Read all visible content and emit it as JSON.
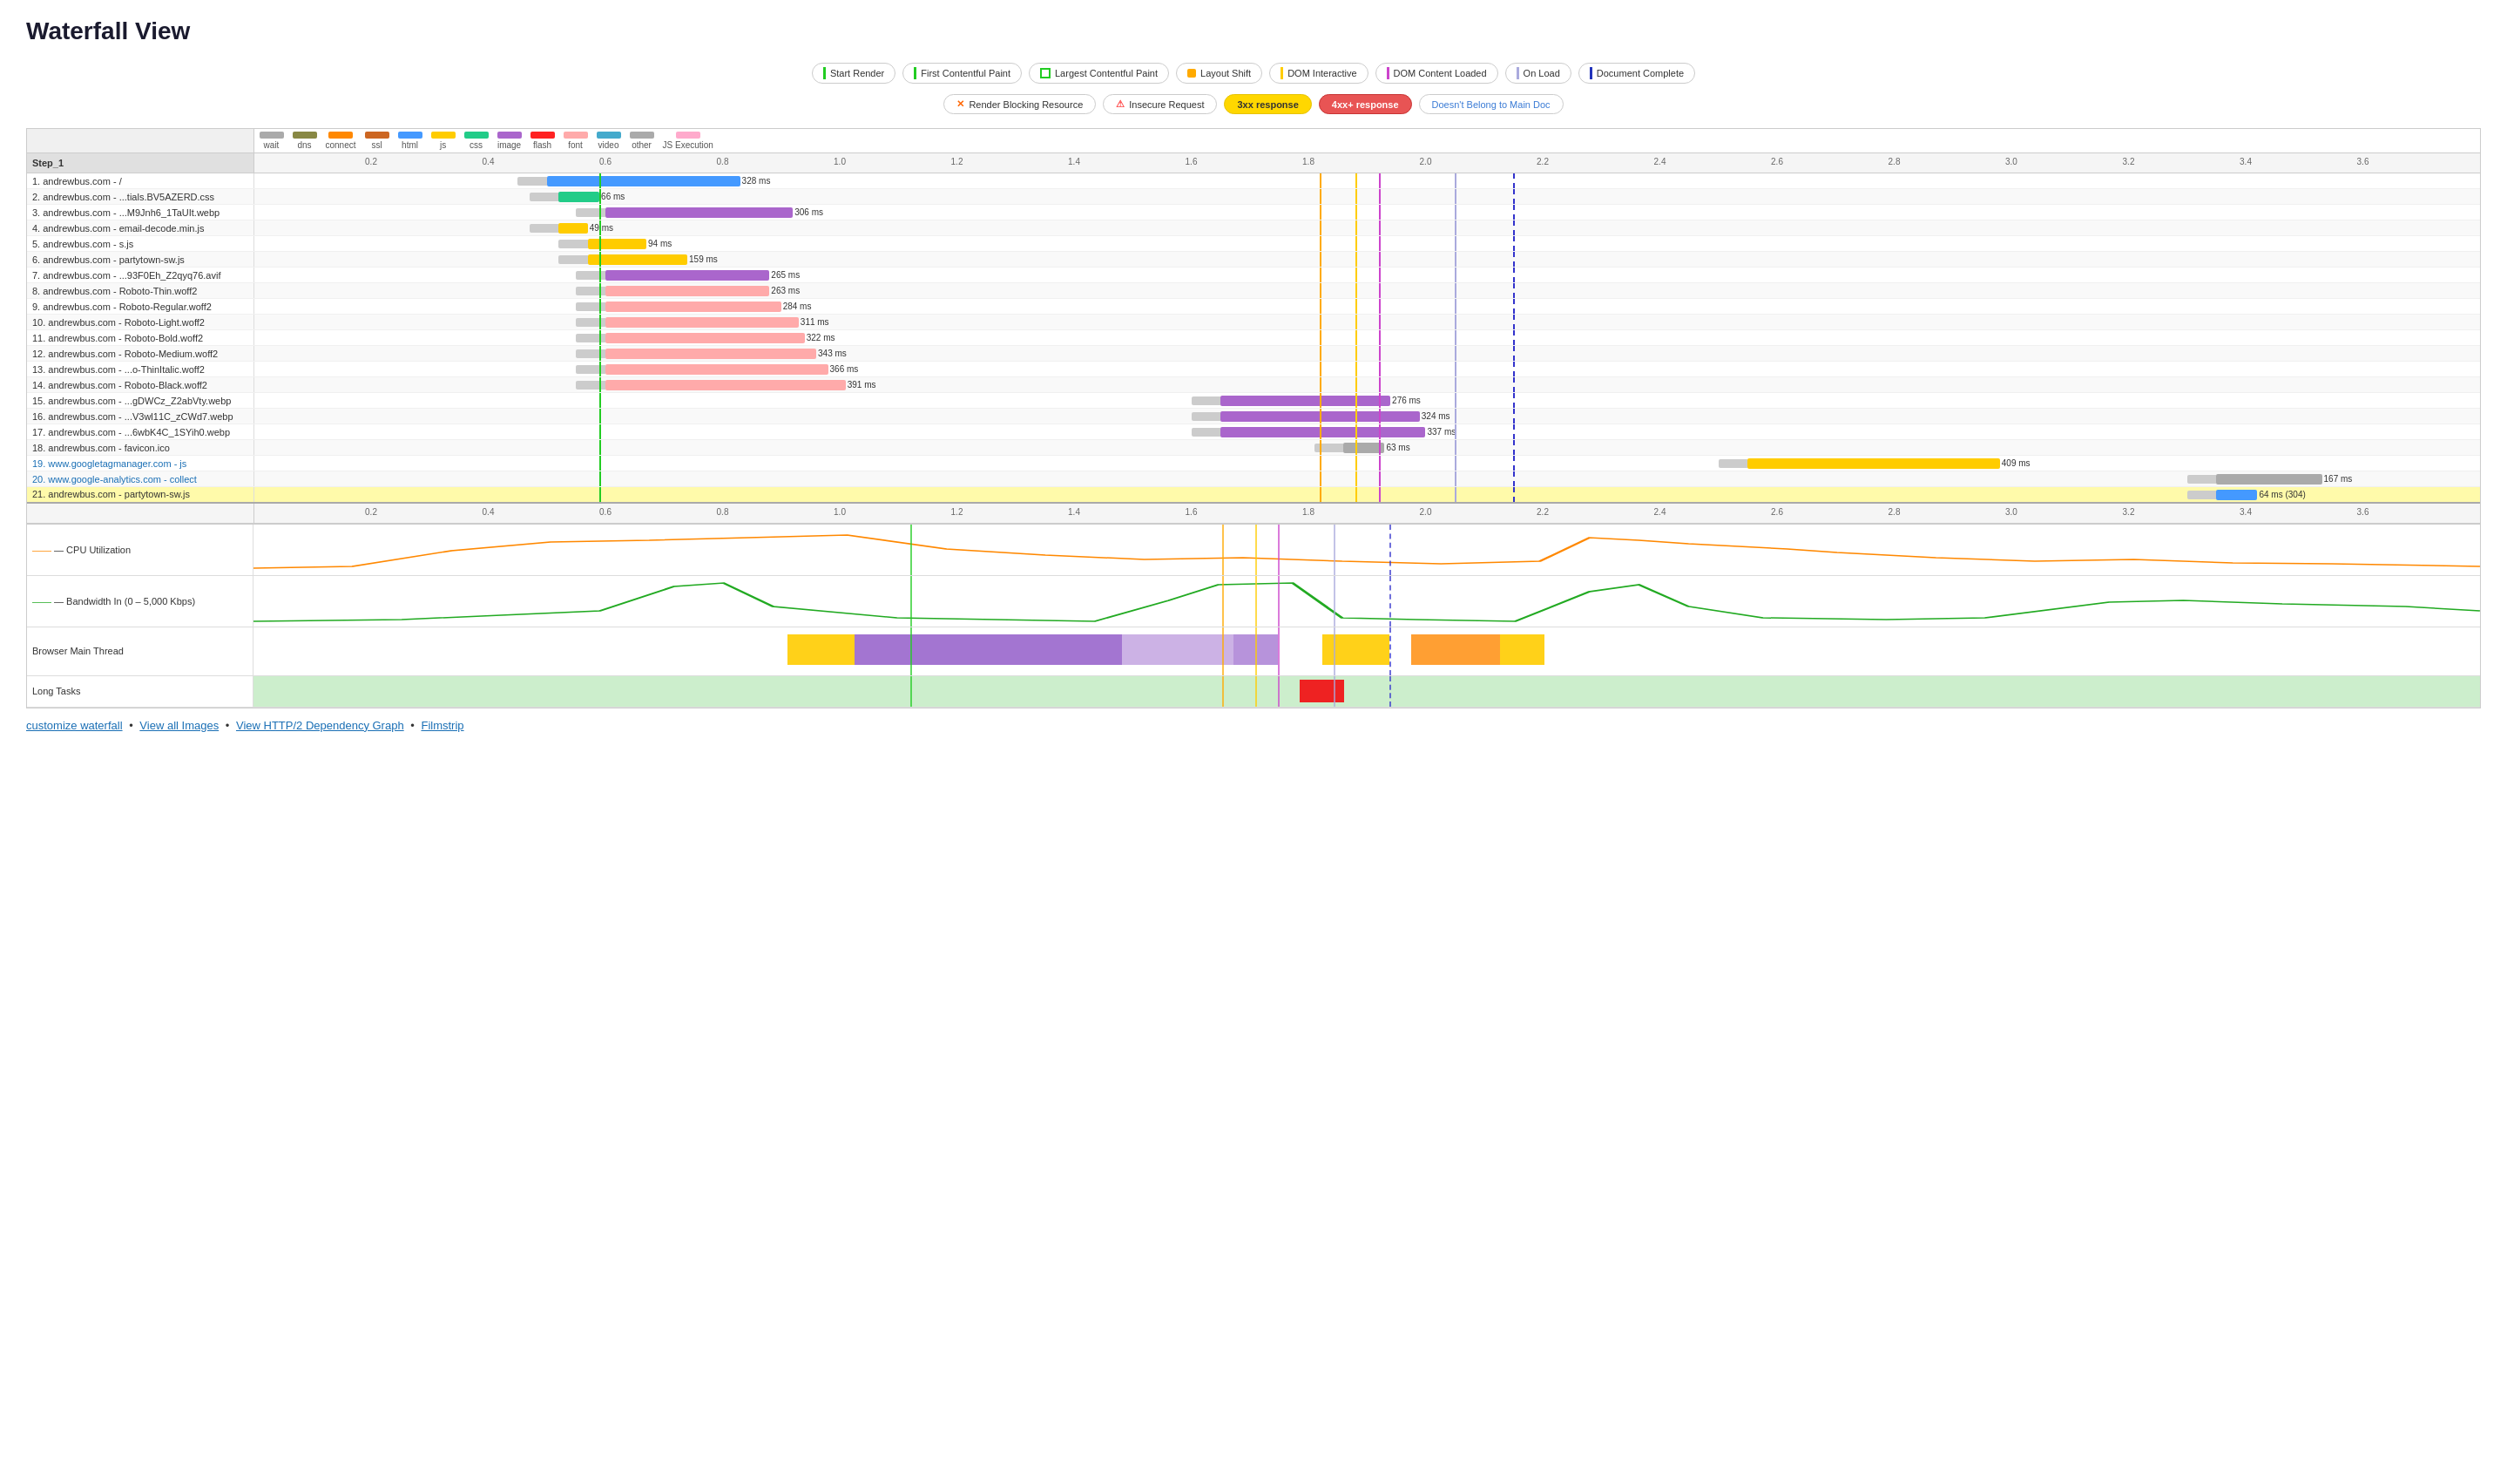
{
  "title": "Waterfall View",
  "legend1": [
    {
      "id": "start-render",
      "label": "Start Render",
      "color": "#22cc22",
      "type": "line"
    },
    {
      "id": "first-contentful-paint",
      "label": "First Contentful Paint",
      "color": "#22cc22",
      "type": "line"
    },
    {
      "id": "largest-contentful-paint",
      "label": "Largest Contentful Paint",
      "color": "#22cc22",
      "type": "dashed"
    },
    {
      "id": "layout-shift",
      "label": "Layout Shift",
      "color": "#ffaa00",
      "type": "dot"
    },
    {
      "id": "dom-interactive",
      "label": "DOM Interactive",
      "color": "#ffcc00",
      "type": "line"
    },
    {
      "id": "dom-content-loaded",
      "label": "DOM Content Loaded",
      "color": "#cc44cc",
      "type": "line"
    },
    {
      "id": "on-load",
      "label": "On Load",
      "color": "#bbbbee",
      "type": "line"
    },
    {
      "id": "document-complete",
      "label": "Document Complete",
      "color": "#1133cc",
      "type": "line"
    }
  ],
  "legend2": [
    {
      "id": "render-blocking",
      "label": "Render Blocking Resource",
      "type": "x-circle",
      "color": "#ff6600"
    },
    {
      "id": "insecure",
      "label": "Insecure Request",
      "type": "warning",
      "color": "#ff4444"
    },
    {
      "id": "3xx",
      "label": "3xx response",
      "type": "badge-yellow"
    },
    {
      "id": "4xx",
      "label": "4xx+ response",
      "type": "badge-red"
    },
    {
      "id": "not-main-doc",
      "label": "Doesn't Belong to Main Doc",
      "type": "text-blue"
    }
  ],
  "type_colors": [
    {
      "name": "wait",
      "color": "#aaaaaa"
    },
    {
      "name": "dns",
      "color": "#888844"
    },
    {
      "name": "connect",
      "color": "#ff8800"
    },
    {
      "name": "ssl",
      "color": "#cc6622"
    },
    {
      "name": "html",
      "color": "#4499ff"
    },
    {
      "name": "js",
      "color": "#ffcc00"
    },
    {
      "name": "css",
      "color": "#22cc88"
    },
    {
      "name": "image",
      "color": "#aa66cc"
    },
    {
      "name": "flash",
      "color": "#ff2222"
    },
    {
      "name": "font",
      "color": "#ffaaaa"
    },
    {
      "name": "video",
      "color": "#44aacc"
    },
    {
      "name": "other",
      "color": "#aaaaaa"
    },
    {
      "name": "JS Execution",
      "color": "#ffaacc"
    }
  ],
  "time_ticks": [
    "0.2",
    "0.4",
    "0.6",
    "0.8",
    "1.0",
    "1.2",
    "1.4",
    "1.6",
    "1.8",
    "2.0",
    "2.2",
    "2.4",
    "2.6",
    "2.8",
    "3.0",
    "3.2",
    "3.4",
    "3.6"
  ],
  "step_label": "Step_1",
  "rows": [
    {
      "num": 1,
      "label": "andrewbus.com - /",
      "timing": "328 ms",
      "type": "html",
      "start": 0.5,
      "width": 0.33,
      "highlight": false
    },
    {
      "num": 2,
      "label": "andrewbus.com - ...tials.BV5AZERD.css",
      "timing": "66 ms",
      "type": "css",
      "start": 0.52,
      "width": 0.07,
      "highlight": false
    },
    {
      "num": 3,
      "label": "andrewbus.com - ...M9Jnh6_1TaUIt.webp",
      "timing": "306 ms",
      "type": "image",
      "start": 0.6,
      "width": 0.32,
      "highlight": false
    },
    {
      "num": 4,
      "label": "andrewbus.com - email-decode.min.js",
      "timing": "49 ms",
      "type": "js",
      "start": 0.52,
      "width": 0.05,
      "highlight": false
    },
    {
      "num": 5,
      "label": "andrewbus.com - s.js",
      "timing": "94 ms",
      "type": "js",
      "start": 0.57,
      "width": 0.1,
      "highlight": false
    },
    {
      "num": 6,
      "label": "andrewbus.com - partytown-sw.js",
      "timing": "159 ms",
      "type": "js",
      "start": 0.57,
      "width": 0.17,
      "highlight": false
    },
    {
      "num": 7,
      "label": "andrewbus.com - ...93F0Eh_Z2qyq76.avif",
      "timing": "265 ms",
      "type": "image",
      "start": 0.6,
      "width": 0.28,
      "highlight": false
    },
    {
      "num": 8,
      "label": "andrewbus.com - Roboto-Thin.woff2",
      "timing": "263 ms",
      "type": "font",
      "start": 0.6,
      "width": 0.28,
      "highlight": false
    },
    {
      "num": 9,
      "label": "andrewbus.com - Roboto-Regular.woff2",
      "timing": "284 ms",
      "type": "font",
      "start": 0.6,
      "width": 0.3,
      "highlight": false
    },
    {
      "num": 10,
      "label": "andrewbus.com - Roboto-Light.woff2",
      "timing": "311 ms",
      "type": "font",
      "start": 0.6,
      "width": 0.33,
      "highlight": false
    },
    {
      "num": 11,
      "label": "andrewbus.com - Roboto-Bold.woff2",
      "timing": "322 ms",
      "type": "font",
      "start": 0.6,
      "width": 0.34,
      "highlight": false
    },
    {
      "num": 12,
      "label": "andrewbus.com - Roboto-Medium.woff2",
      "timing": "343 ms",
      "type": "font",
      "start": 0.6,
      "width": 0.36,
      "highlight": false
    },
    {
      "num": 13,
      "label": "andrewbus.com - ...o-ThinItalic.woff2",
      "timing": "366 ms",
      "type": "font",
      "start": 0.6,
      "width": 0.38,
      "highlight": false
    },
    {
      "num": 14,
      "label": "andrewbus.com - Roboto-Black.woff2",
      "timing": "391 ms",
      "type": "font",
      "start": 0.6,
      "width": 0.41,
      "highlight": false
    },
    {
      "num": 15,
      "label": "andrewbus.com - ...gDWCz_Z2abVty.webp",
      "timing": "276 ms",
      "type": "image",
      "start": 1.65,
      "width": 0.29,
      "highlight": false
    },
    {
      "num": 16,
      "label": "andrewbus.com - ...V3wl11C_zCWd7.webp",
      "timing": "324 ms",
      "type": "image",
      "start": 1.65,
      "width": 0.34,
      "highlight": false
    },
    {
      "num": 17,
      "label": "andrewbus.com - ...6wbK4C_1SYih0.webp",
      "timing": "337 ms",
      "type": "image",
      "start": 1.65,
      "width": 0.35,
      "highlight": false
    },
    {
      "num": 18,
      "label": "andrewbus.com - favicon.ico",
      "timing": "63 ms",
      "type": "other",
      "start": 1.86,
      "width": 0.07,
      "highlight": false
    },
    {
      "num": 19,
      "label": "www.googletagmanager.com - js",
      "timing": "409 ms",
      "type": "js",
      "start": 2.55,
      "width": 0.43,
      "highlight": false,
      "blue": true
    },
    {
      "num": 20,
      "label": "www.google-analytics.com - collect",
      "timing": "167 ms",
      "type": "other",
      "start": 3.35,
      "width": 0.18,
      "highlight": false,
      "blue": true
    },
    {
      "num": 21,
      "label": "andrewbus.com - partytown-sw.js",
      "timing": "64 ms (304)",
      "type": "html",
      "start": 3.35,
      "width": 0.07,
      "highlight": true
    }
  ],
  "vertical_markers": [
    {
      "id": "layout-shift-1",
      "pos": 1.82,
      "color": "#ffaa00",
      "style": "solid"
    },
    {
      "id": "dom-interactive",
      "pos": 1.88,
      "color": "#ffcc00",
      "style": "solid"
    },
    {
      "id": "start-render",
      "pos": 0.59,
      "color": "#22cc22",
      "style": "solid"
    },
    {
      "id": "dom-content-loaded",
      "pos": 1.92,
      "color": "#cc44cc",
      "style": "solid"
    },
    {
      "id": "on-load",
      "pos": 2.05,
      "color": "#aaaadd",
      "style": "solid"
    },
    {
      "id": "document-complete",
      "pos": 2.15,
      "color": "#3333cc",
      "style": "dashed"
    }
  ],
  "bottom_links": [
    {
      "id": "customize-waterfall",
      "label": "customize waterfall",
      "href": "#"
    },
    {
      "id": "view-all-images",
      "label": "View all Images",
      "href": "#"
    },
    {
      "id": "view-http2",
      "label": "View HTTP/2 Dependency Graph",
      "href": "#"
    },
    {
      "id": "filmstrip",
      "label": "Filmstrip",
      "href": "#"
    }
  ],
  "charts": [
    {
      "id": "cpu",
      "label": "— CPU Utilization"
    },
    {
      "id": "bandwidth",
      "label": "— Bandwidth In (0 – 5,000 Kbps)"
    },
    {
      "id": "browser-main-thread",
      "label": "Browser Main Thread"
    },
    {
      "id": "long-tasks",
      "label": "Long Tasks"
    }
  ],
  "footer_text": {
    "browser_main_thread": "Browser Main Thread Long Tasks",
    "customize": "customize waterfall",
    "view_images": "View all Images"
  }
}
